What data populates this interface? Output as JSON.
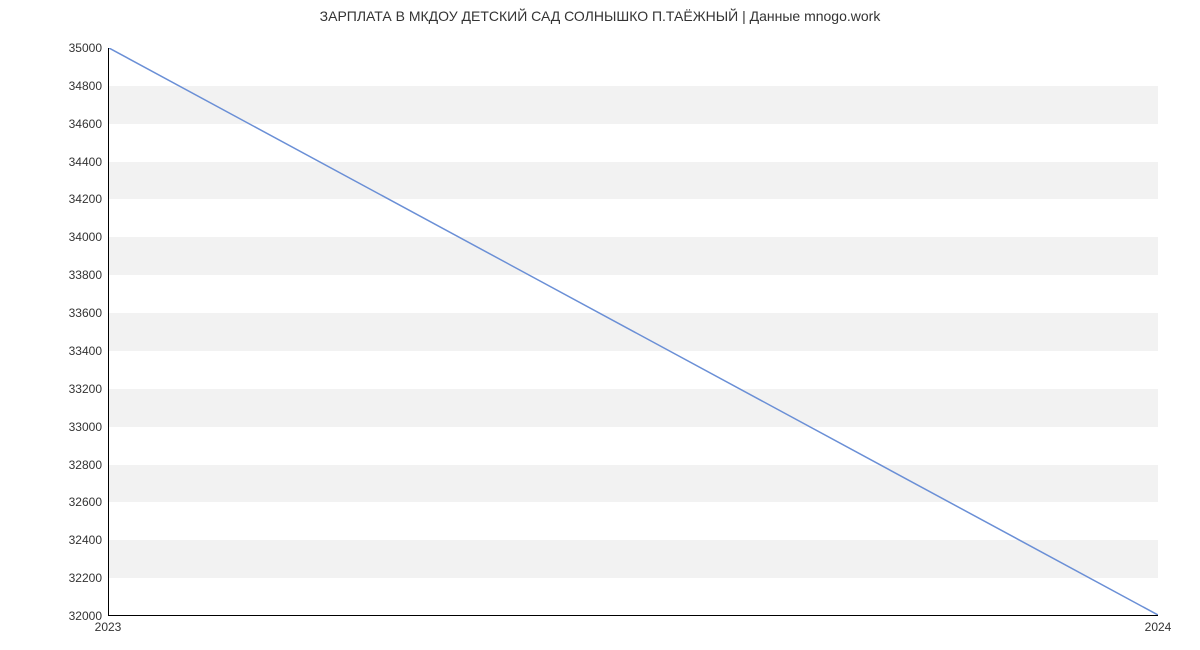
{
  "chart_data": {
    "type": "line",
    "title": "ЗАРПЛАТА В МКДОУ ДЕТСКИЙ САД СОЛНЫШКО П.ТАЁЖНЫЙ | Данные mnogo.work",
    "xlabel": "",
    "ylabel": "",
    "x": [
      2023,
      2024
    ],
    "values": [
      35000,
      32000
    ],
    "xticks": [
      2023,
      2024
    ],
    "yticks": [
      32000,
      32200,
      32400,
      32600,
      32800,
      33000,
      33200,
      33400,
      33600,
      33800,
      34000,
      34200,
      34400,
      34600,
      34800,
      35000
    ],
    "ylim": [
      32000,
      35000
    ],
    "xlim": [
      2023,
      2024
    ],
    "line_color": "#6a8fd6"
  }
}
